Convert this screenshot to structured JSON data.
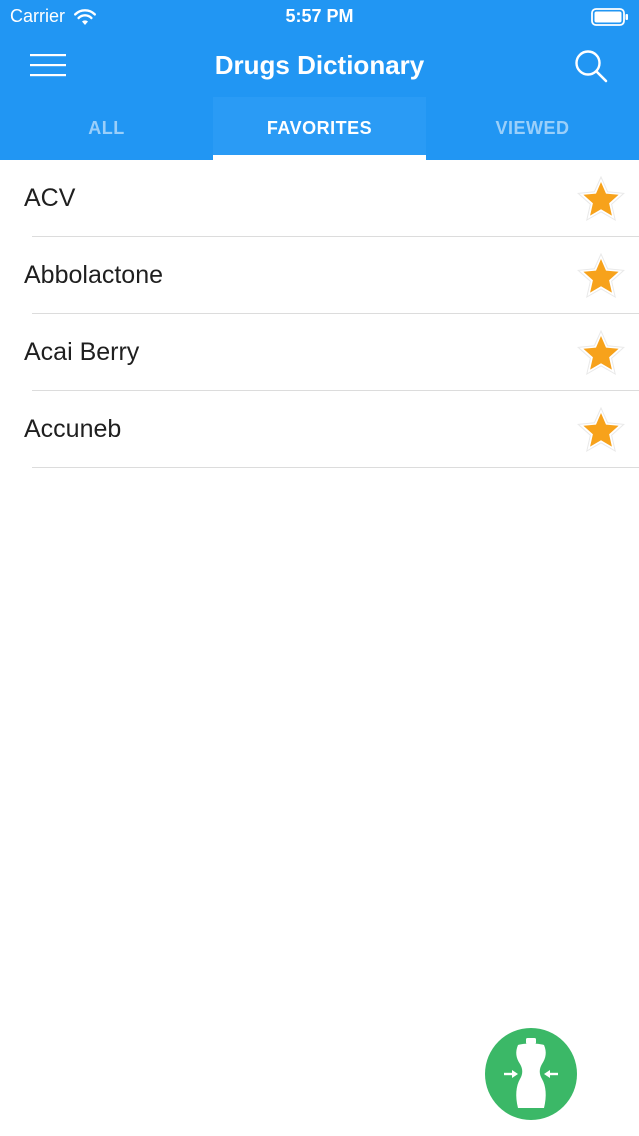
{
  "status_bar": {
    "carrier": "Carrier",
    "time": "5:57 PM"
  },
  "nav": {
    "title": "Drugs Dictionary",
    "menu_icon": "hamburger-menu-icon",
    "search_icon": "search-icon"
  },
  "tabs": [
    {
      "label": "ALL",
      "active": false
    },
    {
      "label": "FAVORITES",
      "active": true
    },
    {
      "label": "VIEWED",
      "active": false
    }
  ],
  "favorites": [
    {
      "name": "ACV",
      "favorite": true
    },
    {
      "name": "Abbolactone",
      "favorite": true
    },
    {
      "name": "Acai Berry",
      "favorite": true
    },
    {
      "name": "Accuneb",
      "favorite": true
    }
  ],
  "fab": {
    "icon": "body-fit-icon"
  },
  "colors": {
    "header": "#2196f3",
    "star": "#f7a21b",
    "fab": "#3bb867"
  }
}
